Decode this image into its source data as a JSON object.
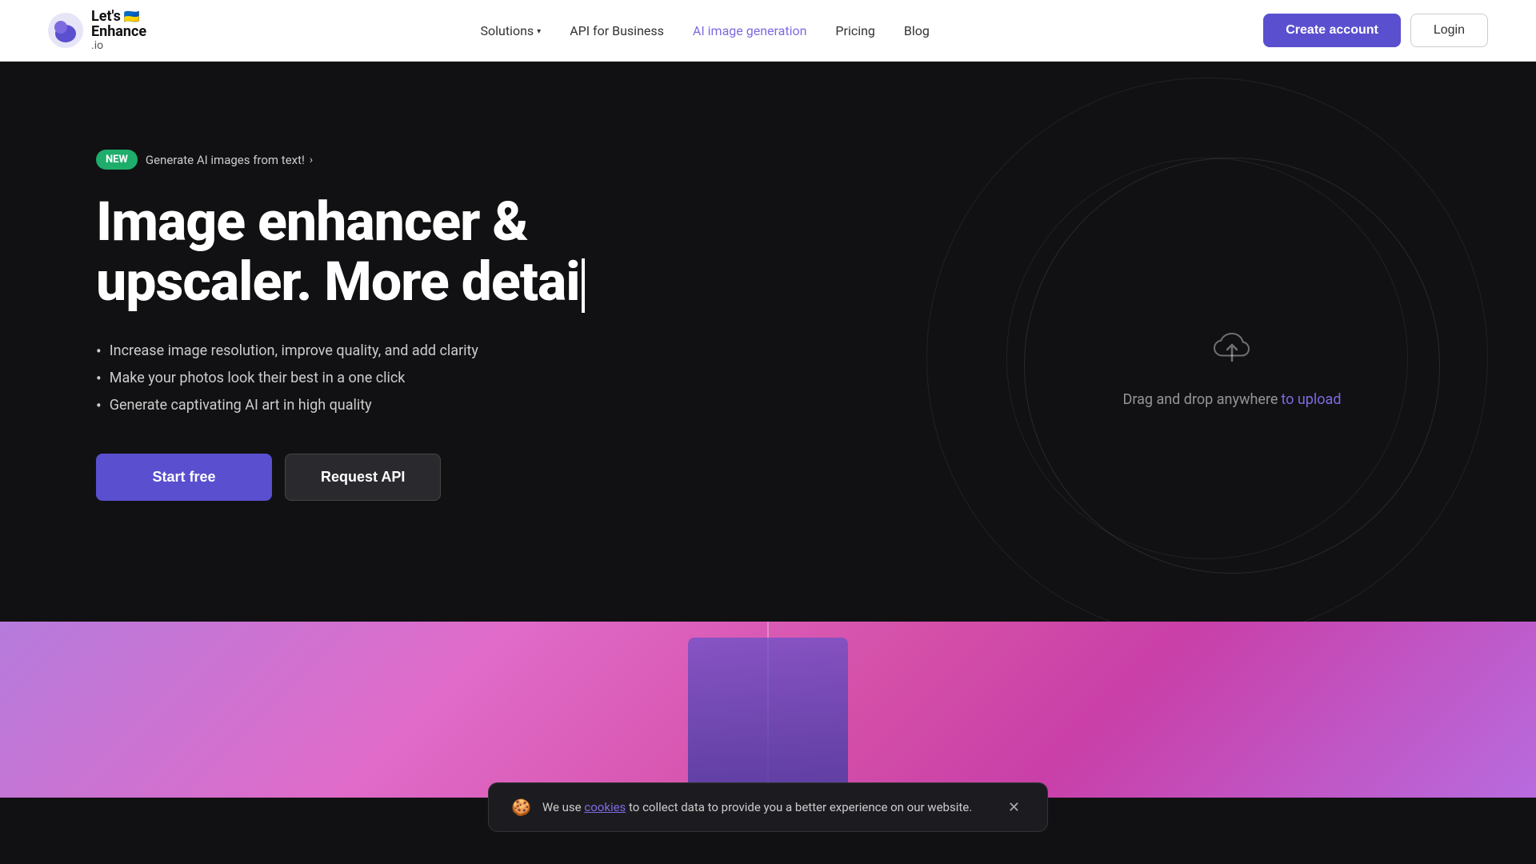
{
  "navbar": {
    "logo_name": "Let's Enhance.io",
    "logo_lets": "Let's",
    "logo_enhance": "Enhance",
    "logo_io": ".io",
    "logo_flag": "🇺🇦",
    "nav_items": [
      {
        "label": "Solutions",
        "has_dropdown": true,
        "active": false
      },
      {
        "label": "API for Business",
        "has_dropdown": false,
        "active": false
      },
      {
        "label": "AI image generation",
        "has_dropdown": false,
        "active": true
      },
      {
        "label": "Pricing",
        "has_dropdown": false,
        "active": false
      },
      {
        "label": "Blog",
        "has_dropdown": false,
        "active": false
      }
    ],
    "create_account_label": "Create account",
    "login_label": "Login"
  },
  "hero": {
    "badge_new": "NEW",
    "badge_text": "Generate AI images from text!",
    "badge_arrow": "›",
    "title_part1": "Image enhancer & upscaler. More detai",
    "title_cursor": "|",
    "bullets": [
      "Increase image resolution, improve quality, and add clarity",
      "Make your photos look their best in a one click",
      "Generate captivating AI art in high quality"
    ],
    "start_free_label": "Start free",
    "request_api_label": "Request API",
    "upload_prompt": "Drag and drop anywhere",
    "upload_link_text": "to upload"
  },
  "cookie": {
    "emoji": "🍪",
    "text_before": "We use",
    "link_text": "cookies",
    "text_after": "to collect data to provide you a better experience on our website.",
    "close_label": "✕"
  }
}
